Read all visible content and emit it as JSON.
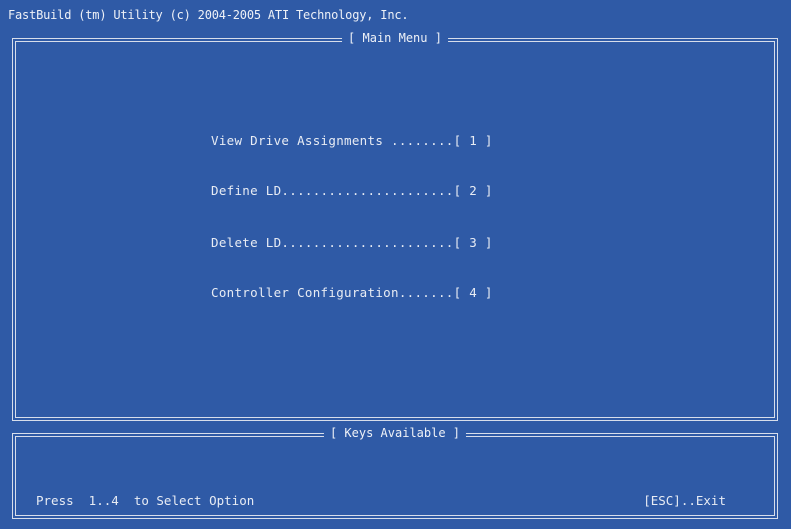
{
  "title_bar": "FastBuild (tm) Utility (c) 2004-2005 ATI Technology, Inc.",
  "main_menu": {
    "title": "[ Main Menu ]",
    "items": [
      {
        "label": "View Drive Assignments ........[ 1 ]"
      },
      {
        "label": "Define LD......................[ 2 ]"
      },
      {
        "label": "Delete LD......................[ 3 ]"
      },
      {
        "label": "Controller Configuration.......[ 4 ]"
      }
    ]
  },
  "keys_panel": {
    "title": "[ Keys Available ]",
    "left_hint": "Press  1..4  to Select Option",
    "right_hint": "[ESC]..Exit"
  },
  "colors": {
    "background": "#2f5aa6",
    "text": "#e8ecf4",
    "border": "#d8deeb"
  }
}
